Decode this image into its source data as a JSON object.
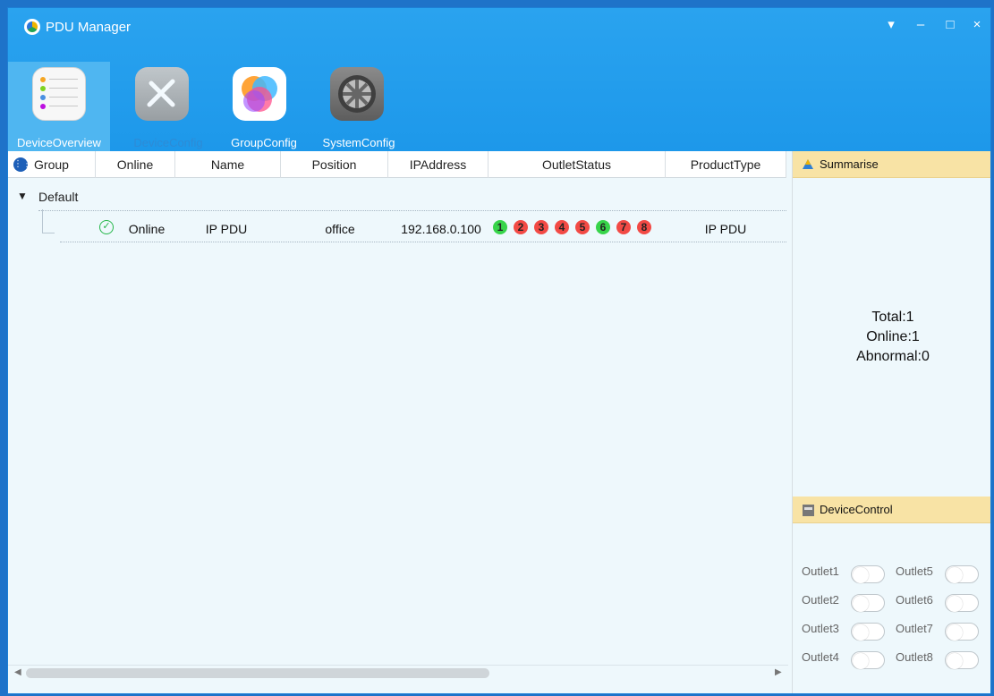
{
  "window": {
    "title": "PDU Manager"
  },
  "nav": {
    "items": [
      {
        "label": "DeviceOverview",
        "icon": "list-icon",
        "state": "active"
      },
      {
        "label": "DeviceConfig",
        "icon": "tools-icon",
        "state": "disabled"
      },
      {
        "label": "GroupConfig",
        "icon": "circles-icon",
        "state": "normal"
      },
      {
        "label": "SystemConfig",
        "icon": "gear-icon",
        "state": "normal"
      }
    ]
  },
  "list": {
    "columns": [
      "Group",
      "Online",
      "Name",
      "Position",
      "IPAddress",
      "OutletStatus",
      "ProductType"
    ],
    "groups": [
      {
        "name": "Default",
        "devices": [
          {
            "online": "Online",
            "name": "IP PDU",
            "position": "office",
            "ip": "192.168.0.100",
            "outlets": [
              {
                "number": "1",
                "status": "on",
                "color": "#37d44a"
              },
              {
                "number": "2",
                "status": "off",
                "color": "#f24a45"
              },
              {
                "number": "3",
                "status": "off",
                "color": "#f24a45"
              },
              {
                "number": "4",
                "status": "off",
                "color": "#f24a45"
              },
              {
                "number": "5",
                "status": "off",
                "color": "#f24a45"
              },
              {
                "number": "6",
                "status": "on",
                "color": "#37d44a"
              },
              {
                "number": "7",
                "status": "off",
                "color": "#f24a45"
              },
              {
                "number": "8",
                "status": "off",
                "color": "#f24a45"
              }
            ],
            "product_type": "IP PDU"
          }
        ]
      }
    ]
  },
  "summary": {
    "title": "Summarise",
    "total": "Total:1",
    "online": "Online:1",
    "abnormal": "Abnormal:0"
  },
  "device_control": {
    "title": "DeviceControl",
    "outlets": [
      {
        "label": "Outlet1"
      },
      {
        "label": "Outlet5"
      },
      {
        "label": "Outlet2"
      },
      {
        "label": "Outlet6"
      },
      {
        "label": "Outlet3"
      },
      {
        "label": "Outlet7"
      },
      {
        "label": "Outlet4"
      },
      {
        "label": "Outlet8"
      }
    ]
  },
  "colors": {
    "titlebar": "#1d98ea",
    "content_bg": "#eef8fc",
    "panel_header": "#f8e3a5",
    "online": "#26b74a",
    "outlet_on": "#37d44a",
    "outlet_off": "#f24a45"
  }
}
